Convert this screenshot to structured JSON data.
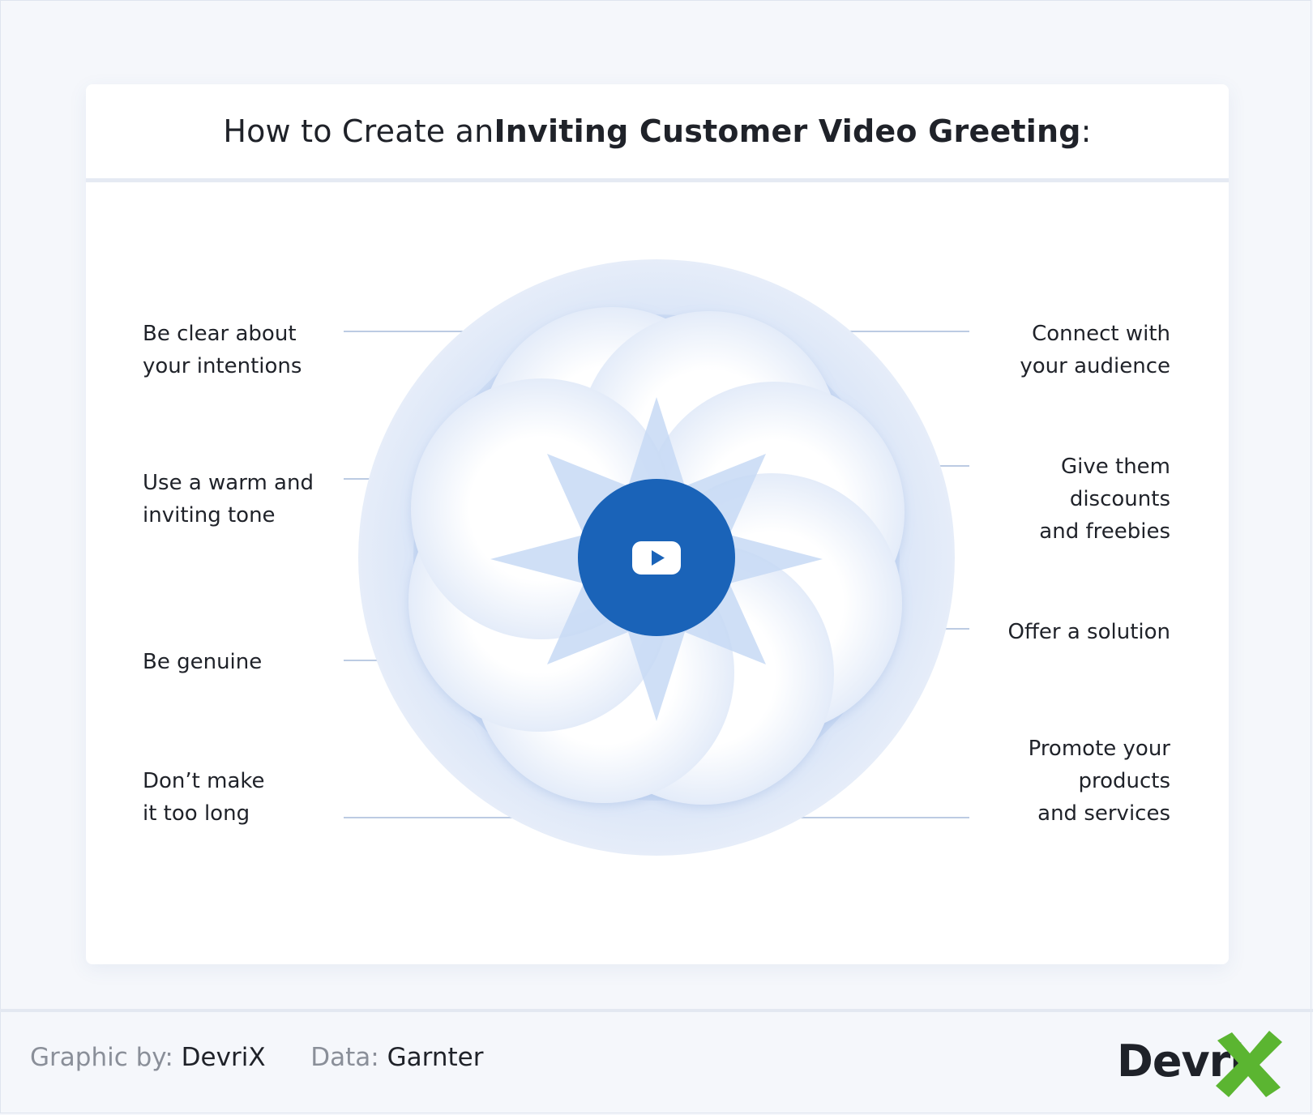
{
  "title": {
    "prefix": "How to Create an ",
    "emphasis": "Inviting Customer Video Greeting",
    "suffix": ":"
  },
  "center_icon": "play-video-icon",
  "tips": {
    "left": [
      "Be clear about\nyour intentions",
      "Use a warm and\ninviting tone",
      "Be genuine",
      "Don’t make\nit too long"
    ],
    "right": [
      "Connect with\nyour audience",
      "Give them\ndiscounts\nand freebies",
      "Offer a solution",
      "Promote your\nproducts\nand services"
    ]
  },
  "footer": {
    "graphic_label": "Graphic by:",
    "graphic_value": "DevriX",
    "data_label": "Data:",
    "data_value": "Garnter"
  },
  "logo": {
    "text": "Devri",
    "mark_color": "#5bb531"
  },
  "colors": {
    "accent_dark": "#1a63b8",
    "accent_light": "#b7cff0",
    "ring": "#dce6f7",
    "connector": "#bccbe3"
  }
}
